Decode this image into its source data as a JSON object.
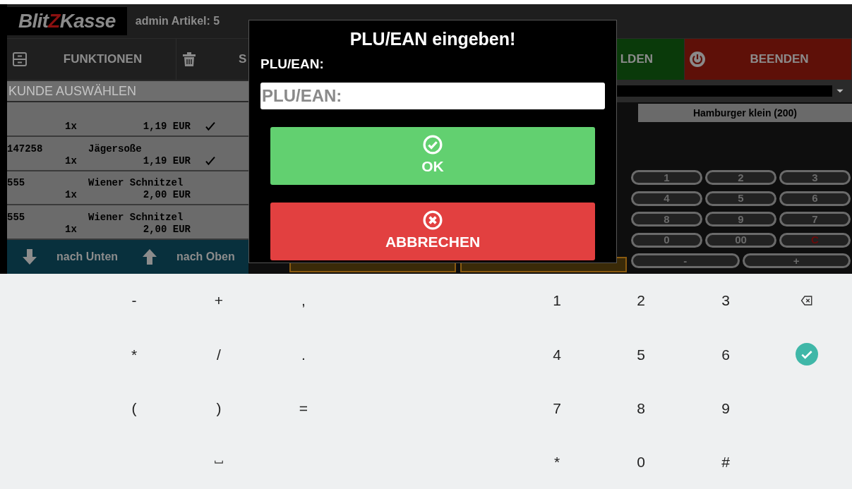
{
  "header": {
    "logo": [
      {
        "text": "Blit",
        "kind": "word"
      },
      {
        "text": "Z",
        "kind": "bolt"
      },
      {
        "text": "Kasse",
        "kind": "word"
      }
    ],
    "user_info": "admin Artikel: 5"
  },
  "menu": [
    {
      "label": "FUNKTIONEN",
      "color": "#1f1f1f"
    },
    {
      "label": "S",
      "color": "#1f1f1f"
    },
    {
      "label": "LDEN",
      "color": "#0a3a0a"
    },
    {
      "label": "BEENDEN",
      "color": "#5e1008"
    }
  ],
  "customer_select": {
    "placeholder": "KUNDE AUSWÄHLEN"
  },
  "receipt_rows": [
    {
      "qty": "1x",
      "price": "1,19 EUR",
      "checked": true
    },
    {
      "code": "147258",
      "name": "Jägersoße",
      "qty": "1x",
      "price": "1,19 EUR",
      "checked": true
    },
    {
      "code": "555",
      "name": "Wiener Schnitzel",
      "qty": "1x",
      "price": "2,00 EUR",
      "checked": false
    },
    {
      "code": "555",
      "name": "Wiener Schnitzel",
      "qty": "1x",
      "price": "2,00 EUR",
      "checked": false
    }
  ],
  "scroll_buttons": [
    "nach Unten",
    "nach Oben"
  ],
  "products": [
    "Hamburger klein (200)"
  ],
  "numpad": [
    "1",
    "2",
    "3",
    "4",
    "5",
    "6",
    "8",
    "9",
    "7",
    "0",
    "00",
    "C",
    "-",
    "+"
  ],
  "dialog": {
    "title": "PLU/EAN eingeben!",
    "label": "PLU/EAN:",
    "field": {
      "placeholder": "PLU/EAN:"
    },
    "ok": "OK",
    "cancel": "ABBRECHEN"
  },
  "keyboard": {
    "rows": [
      {
        "symbols": [
          "-",
          "+",
          ","
        ],
        "digits": [
          "1",
          "2",
          "3"
        ]
      },
      {
        "symbols": [
          "*",
          "/",
          "."
        ],
        "digits": [
          "4",
          "5",
          "6"
        ]
      },
      {
        "symbols": [
          "(",
          ")",
          "="
        ],
        "digits": [
          "7",
          "8",
          "9"
        ]
      },
      {
        "digits": [
          "*",
          "0",
          "#"
        ]
      }
    ]
  }
}
